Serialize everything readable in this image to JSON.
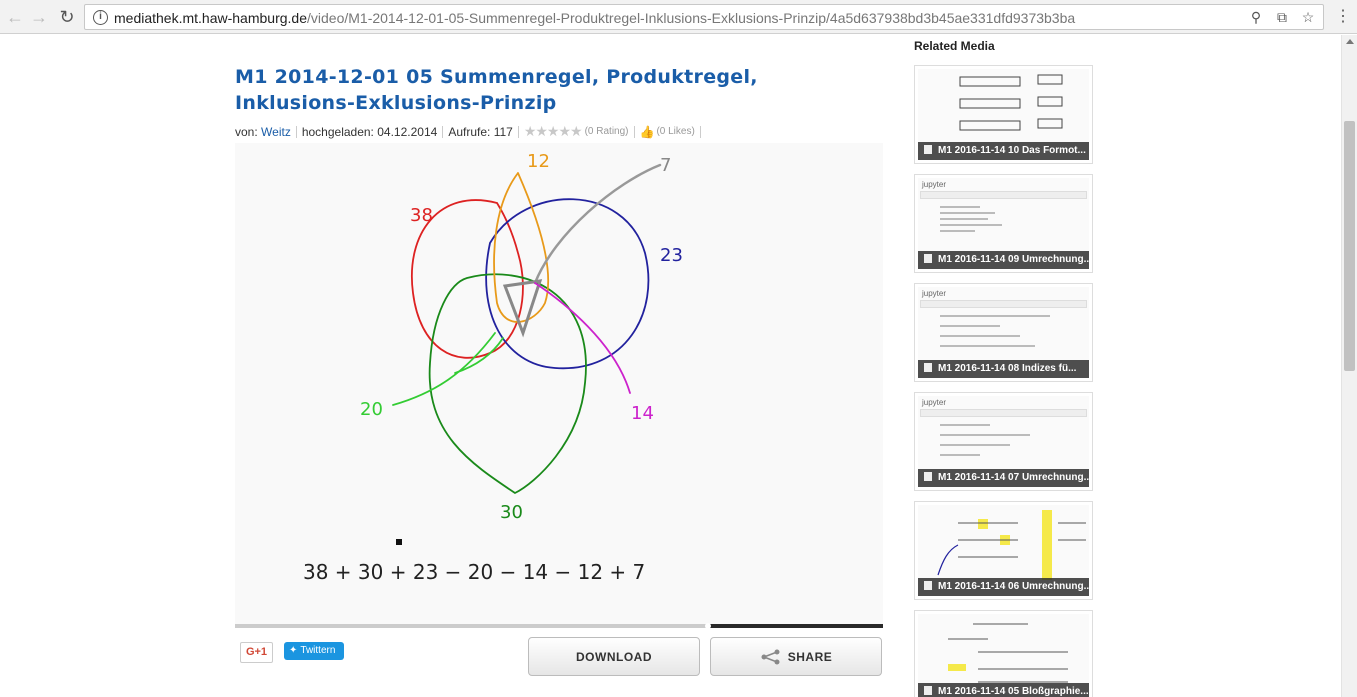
{
  "browser": {
    "url_host": "mediathek.mt.haw-hamburg.de",
    "url_path": "/video/M1-2014-12-01-05-Summenregel-Produktregel-Inklusions-Exklusions-Prinzip/4a5d637938bd3b45ae331dfd9373b3ba"
  },
  "video": {
    "title": "M1 2014-12-01 05 Summenregel, Produktregel, Inklusions-Exklusions-Prinzip",
    "by_label": "von:",
    "author": "Weitz",
    "uploaded_label": "hochgeladen:",
    "uploaded_date": "04.12.2014",
    "views_label": "Aufrufe:",
    "views": "117",
    "rating_text": "(0 Rating)",
    "likes_text": "(0 Likes)",
    "progress": 0.73
  },
  "whiteboard": {
    "labels": {
      "red": "38",
      "orange": "12",
      "grey": "7",
      "blue": "23",
      "green": "20",
      "magenta": "14",
      "bottom": "30"
    },
    "equation": "38 + 30 + 23 − 20 − 14 − 12 + 7"
  },
  "social": {
    "gplus_label": "G+1",
    "twitter_label": "Twittern"
  },
  "actions": {
    "download_label": "DOWNLOAD",
    "share_label": "SHARE"
  },
  "related": {
    "title": "Related Media",
    "items": [
      {
        "label": "M1 2016-11-14 10 Das Formot..."
      },
      {
        "label": "M1 2016-11-14 09 Umrechnung..."
      },
      {
        "label": "M1 2016-11-14 08 Indizes fü..."
      },
      {
        "label": "M1 2016-11-14 07 Umrechnung..."
      },
      {
        "label": "M1 2016-11-14 06 Umrechnung..."
      },
      {
        "label": "M1 2016-11-14 05 Bloßgraphie..."
      }
    ]
  }
}
